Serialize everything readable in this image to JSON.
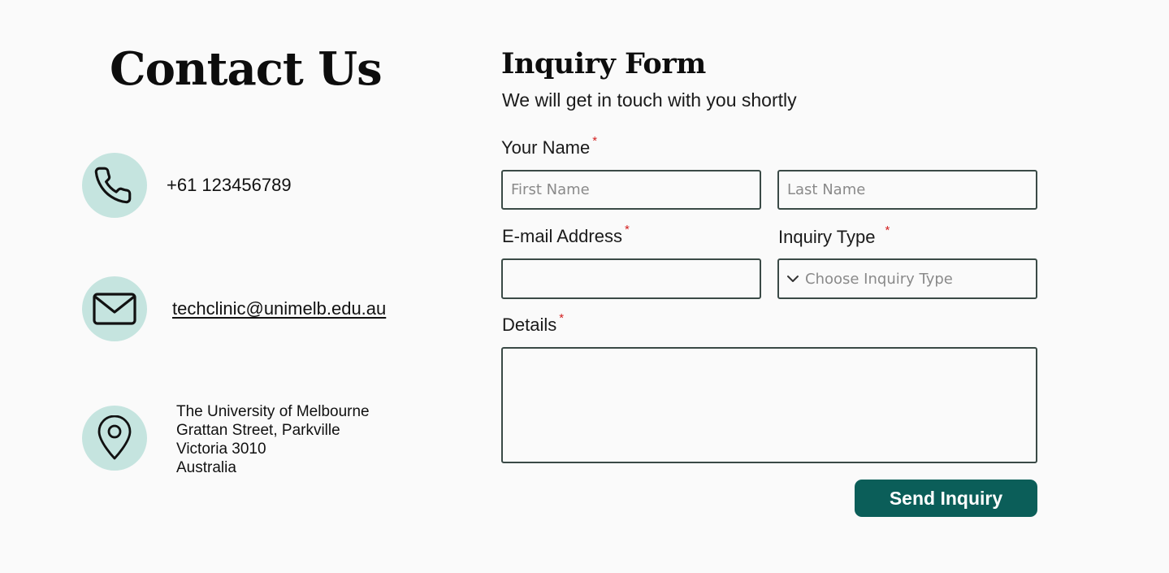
{
  "contact": {
    "title": "Contact Us",
    "phone": "+61 123456789",
    "email": "techclinic@unimelb.edu.au",
    "address_lines": [
      "The University of Melbourne",
      "Grattan Street, Parkville",
      "Victoria 3010",
      "Australia"
    ],
    "icons": [
      "phone-icon",
      "mail-icon",
      "location-pin-icon"
    ]
  },
  "form": {
    "title": "Inquiry Form",
    "subtitle": "We will get in touch with you shortly",
    "required_marker": "*",
    "name_label": "Your Name",
    "first_name_placeholder": "First Name",
    "last_name_placeholder": "Last Name",
    "email_label": "E-mail Address",
    "email_value": "",
    "inquiry_type_label": "Inquiry Type",
    "inquiry_type_selected": "Choose Inquiry Type",
    "details_label": "Details",
    "details_value": "",
    "submit_label": "Send Inquiry"
  },
  "colors": {
    "icon_circle_bg": "#c5e4df",
    "button_bg": "#0b5e59",
    "required_marker": "#d32020",
    "input_border": "#3a4a46",
    "page_bg": "#fafafa"
  }
}
